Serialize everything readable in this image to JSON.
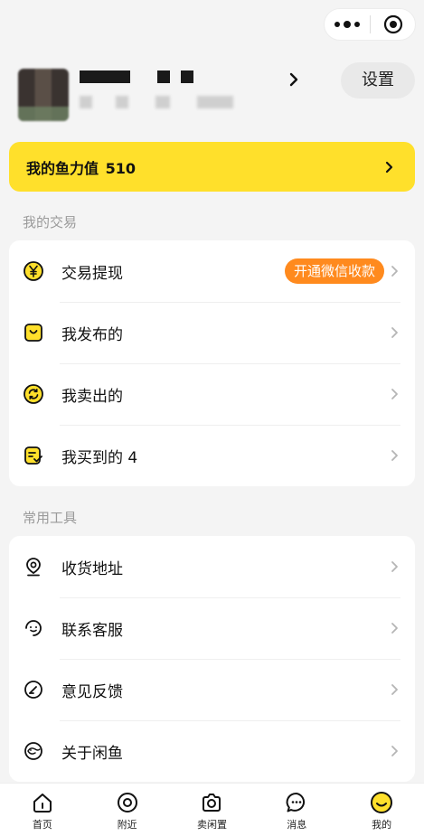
{
  "profile": {
    "settings_label": "设置"
  },
  "fish_card": {
    "label": "我的鱼力值",
    "value": "510"
  },
  "trade": {
    "title": "我的交易",
    "items": [
      {
        "label": "交易提现",
        "icon": "yen-coin-icon",
        "badge": "开通微信收款"
      },
      {
        "label": "我发布的",
        "icon": "bag-icon"
      },
      {
        "label": "我卖出的",
        "icon": "refresh-coin-icon"
      },
      {
        "label": "我买到的 4",
        "icon": "receipt-check-icon"
      }
    ]
  },
  "tools": {
    "title": "常用工具",
    "items": [
      {
        "label": "收货地址",
        "icon": "location-pin-icon"
      },
      {
        "label": "联系客服",
        "icon": "headset-icon"
      },
      {
        "label": "意见反馈",
        "icon": "feedback-pen-icon"
      },
      {
        "label": "关于闲鱼",
        "icon": "fish-logo-icon"
      }
    ]
  },
  "tabbar": {
    "items": [
      {
        "label": "首页",
        "icon": "home-icon"
      },
      {
        "label": "附近",
        "icon": "nearby-icon"
      },
      {
        "label": "卖闲置",
        "icon": "camera-icon"
      },
      {
        "label": "消息",
        "icon": "message-icon"
      },
      {
        "label": "我的",
        "icon": "smiley-icon",
        "active": true
      }
    ]
  },
  "colors": {
    "accent": "#ffe02b",
    "badge": "#ff8a1e",
    "background": "#f4f4f4"
  }
}
